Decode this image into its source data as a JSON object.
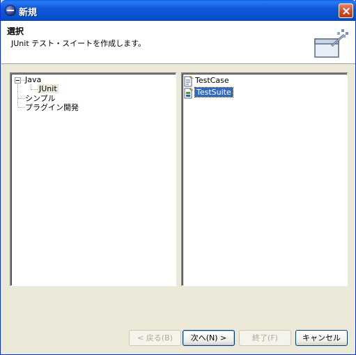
{
  "window": {
    "title": "新規"
  },
  "header": {
    "title": "選択",
    "description": "JUnit テスト・スイートを作成します。"
  },
  "left_tree": {
    "items": [
      {
        "label": "Java",
        "expanded": true
      },
      {
        "label": "JUnit",
        "selected": true
      },
      {
        "label": "シンプル"
      },
      {
        "label": "プラグイン開発"
      }
    ]
  },
  "right_list": {
    "items": [
      {
        "label": "TestCase"
      },
      {
        "label": "TestSuite",
        "selected": true
      }
    ]
  },
  "buttons": {
    "back": "< 戻る(B)",
    "next": "次へ(N) >",
    "finish": "終了(F)",
    "cancel": "キャンセル"
  },
  "colors": {
    "selection": "#316ac5",
    "titlebar": "#0a5fe0",
    "dialog_bg": "#ece9d8"
  }
}
